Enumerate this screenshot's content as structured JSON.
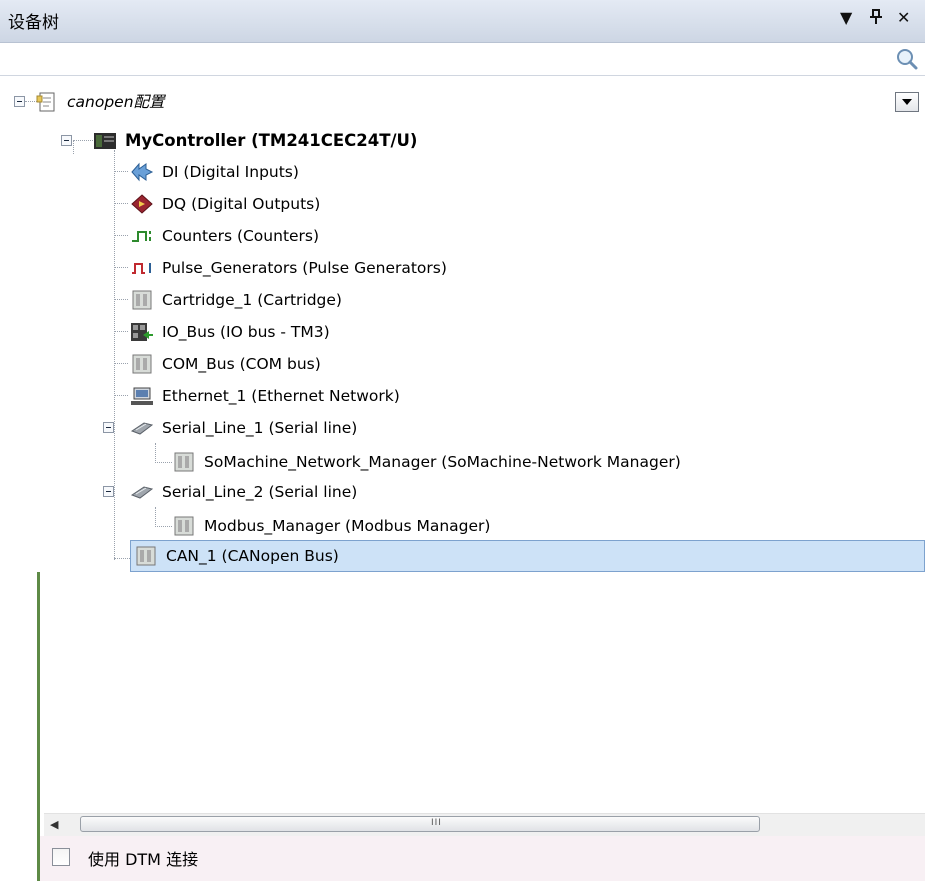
{
  "panel": {
    "title": "设备树",
    "controls": {
      "menu": "▼",
      "pin": "ᚊ",
      "close": "✕"
    }
  },
  "search": {
    "value": "",
    "placeholder": "",
    "icon": "magnifier-icon"
  },
  "tree": {
    "root": {
      "label": "canopen配置",
      "icon": "project-icon"
    },
    "controller": {
      "label": "MyController (TM241CEC24T/U)",
      "icon": "controller-icon"
    },
    "items": [
      {
        "label": "DI (Digital Inputs)",
        "icon": "digital-inputs-icon"
      },
      {
        "label": "DQ (Digital Outputs)",
        "icon": "digital-outputs-icon"
      },
      {
        "label": "Counters (Counters)",
        "icon": "counters-icon"
      },
      {
        "label": "Pulse_Generators (Pulse Generators)",
        "icon": "pulse-icon"
      },
      {
        "label": "Cartridge_1 (Cartridge)",
        "icon": "module-icon"
      },
      {
        "label": "IO_Bus (IO bus - TM3)",
        "icon": "io-bus-icon"
      },
      {
        "label": "COM_Bus (COM bus)",
        "icon": "module-icon"
      },
      {
        "label": "Ethernet_1 (Ethernet Network)",
        "icon": "ethernet-icon"
      },
      {
        "label": "Serial_Line_1 (Serial line)",
        "icon": "serial-icon"
      },
      {
        "label": "SoMachine_Network_Manager (SoMachine-Network Manager)",
        "icon": "module-icon"
      },
      {
        "label": "Serial_Line_2 (Serial line)",
        "icon": "serial-icon"
      },
      {
        "label": "Modbus_Manager (Modbus Manager)",
        "icon": "module-icon"
      },
      {
        "label": "CAN_1 (CANopen Bus)",
        "icon": "module-icon"
      }
    ]
  },
  "scrollbar": {
    "left_arrow": "◀",
    "grip": "III"
  },
  "footer": {
    "checkbox_label": "使用 DTM 连接",
    "checked": false
  },
  "colors": {
    "selection": "#cde2f7",
    "title_bar": "#cdd6e4",
    "left_border": "#5e8a46"
  }
}
